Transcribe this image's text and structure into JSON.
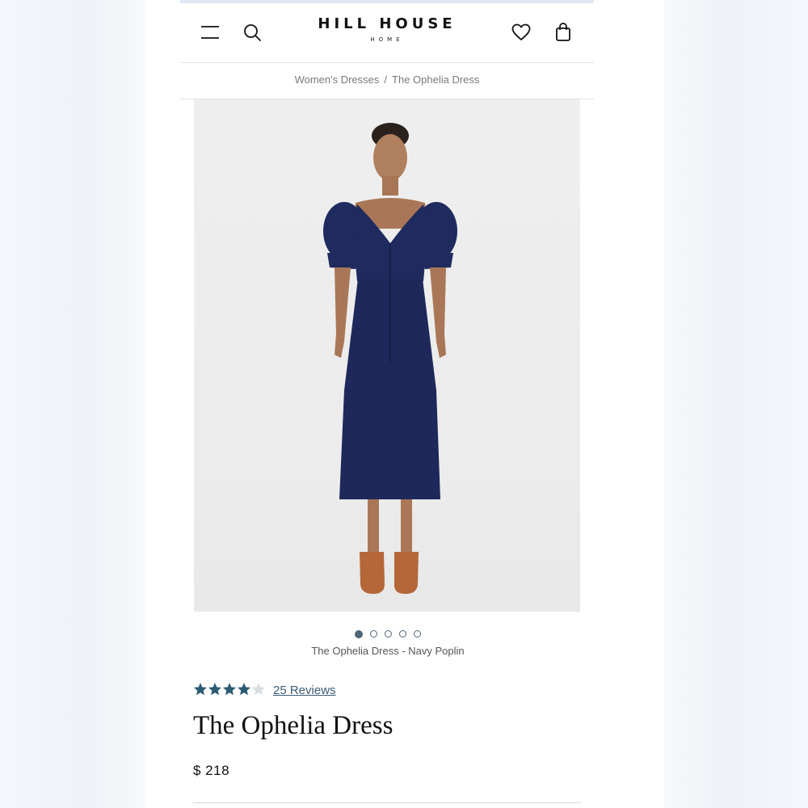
{
  "header": {
    "brand_name": "HILL HOUSE",
    "brand_sub": "HOME",
    "icons": [
      "menu-icon",
      "search-icon",
      "heart-icon",
      "bag-icon"
    ]
  },
  "breadcrumb": {
    "items": [
      "Women's Dresses",
      "The Ophelia Dress"
    ],
    "separator": "/"
  },
  "gallery": {
    "slide_count": 5,
    "active_index": 0,
    "caption": "The Ophelia Dress - Navy Poplin"
  },
  "product": {
    "rating": 4.4,
    "rating_max": 5,
    "reviews_label": "25 Reviews",
    "title": "The Ophelia Dress",
    "price": "$ 218"
  },
  "colors": {
    "star": "#2d5b72",
    "dot": "#4f6677",
    "dress": "#1f2a5e",
    "shoes": "#b5673a"
  }
}
